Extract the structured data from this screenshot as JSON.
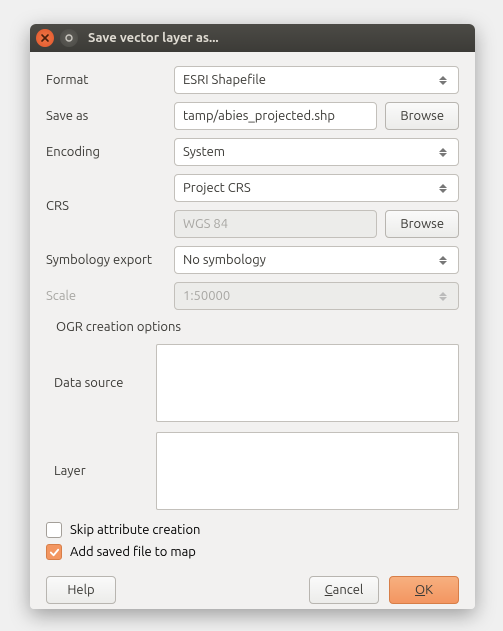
{
  "titlebar": {
    "title": "Save vector layer as..."
  },
  "form": {
    "format_label": "Format",
    "format_value": "ESRI Shapefile",
    "saveas_label": "Save as",
    "saveas_value": "tamp/abies_projected.shp",
    "browse1": "Browse",
    "encoding_label": "Encoding",
    "encoding_value": "System",
    "crs_label": "CRS",
    "crs_mode_value": "Project CRS",
    "crs_name_value": "WGS 84",
    "browse2": "Browse",
    "symbology_label": "Symbology export",
    "symbology_value": "No symbology",
    "scale_label": "Scale",
    "scale_value": "1:50000"
  },
  "ogr": {
    "group_title": "OGR creation options",
    "datasource_label": "Data source",
    "layer_label": "Layer"
  },
  "checks": {
    "skip_label": "Skip attribute creation",
    "add_label": "Add saved file to map"
  },
  "buttons": {
    "help": "Help",
    "cancel_pre": "C",
    "cancel_rest": "ancel",
    "ok_pre": "O",
    "ok_rest": "K"
  }
}
